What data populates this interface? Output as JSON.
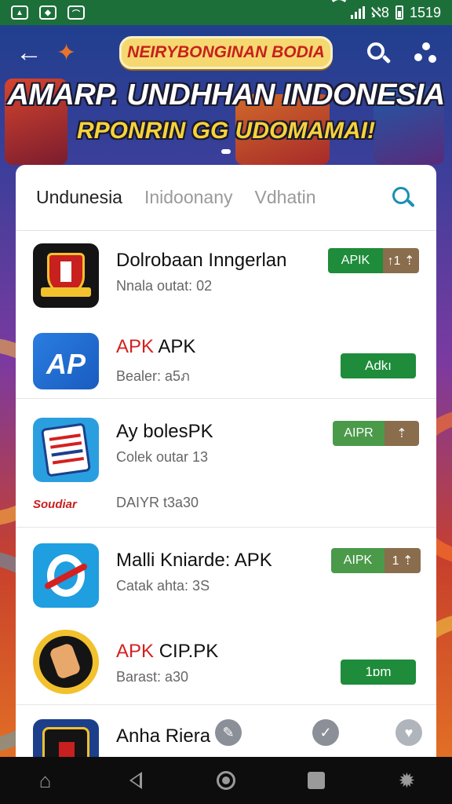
{
  "status_bar": {
    "left_icons": [
      "image-icon",
      "gallery-icon",
      "photo-icon"
    ],
    "right_text": "ℵ8",
    "time": "1519"
  },
  "header": {
    "banner_label": "NEIRYBONGINAN BODIA",
    "headline": "AMARP. UNDHHAN INDONESIA",
    "subheadline": "RPONRIN GG UDOMAMAI!"
  },
  "tabs": [
    {
      "label": "Undunesia",
      "active": true
    },
    {
      "label": "Inidoonany",
      "active": false
    },
    {
      "label": "Vdhatin",
      "active": false
    }
  ],
  "apps": [
    {
      "title": "Dolrobaan Inngerlan",
      "subtitle": "Nnala outat: 02",
      "button_a": "APIK",
      "button_b": "↑1 ⇡"
    },
    {
      "title_red": "APK",
      "title_rest": " APK",
      "subtitle": "Bealer: a5ภ",
      "button": "Adkı"
    },
    {
      "title": "Ay bolesPK",
      "subtitle": "Colek outar 13",
      "brand": "Soudiar",
      "extra": "DAIYR t3a30",
      "button_a": "AIPR",
      "button_b": "⇡"
    },
    {
      "title": "Malli Kniarde: APK",
      "subtitle": "Catak ahta: 3S",
      "button_a": "AIPK",
      "button_b": "1 ⇡"
    },
    {
      "title_red": "APK",
      "title_rest": " CIP.PK",
      "subtitle": "Barast: a30",
      "button": "1ɒm"
    },
    {
      "title": "Anha Riera"
    }
  ],
  "colors": {
    "status_bar": "#1d6f3a",
    "button_green": "#1e8c3a",
    "button_brown": "#8a6d4d",
    "accent_blue": "#1a8fb5",
    "headline_yellow": "#f7d23a"
  }
}
